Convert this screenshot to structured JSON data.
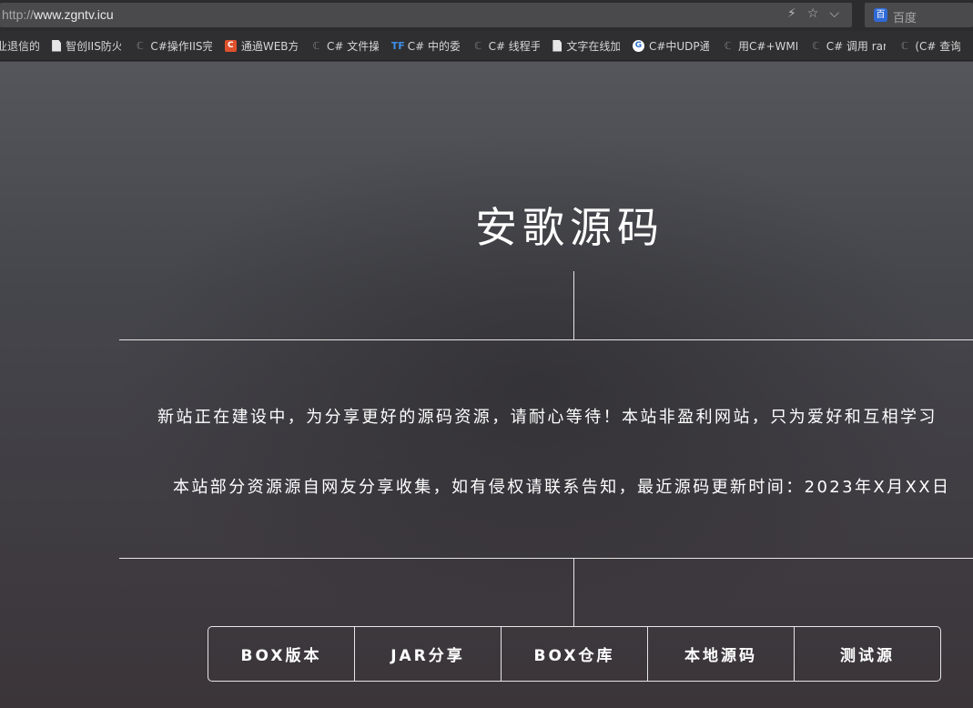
{
  "browser": {
    "url_protocol": "http://",
    "url_host": "www.zgntv.icu",
    "url_icons": [
      "lightning-icon",
      "star-icon",
      "chevron-down-icon"
    ],
    "search_logo": "百",
    "search_placeholder": "百度"
  },
  "bookmarks": [
    {
      "icon": "none",
      "label": "业退信的"
    },
    {
      "icon": "doc",
      "label": "智创IIS防火"
    },
    {
      "icon": "csdn",
      "label": "C#操作IIS完"
    },
    {
      "icon": "c",
      "label": "通過WEB方"
    },
    {
      "icon": "csdn",
      "label": "C# 文件操"
    },
    {
      "icon": "tf",
      "label": "C# 中的委"
    },
    {
      "icon": "csdn",
      "label": "C# 线程手"
    },
    {
      "icon": "doc",
      "label": "文字在线加"
    },
    {
      "icon": "g",
      "label": "C#中UDP通"
    },
    {
      "icon": "csdn",
      "label": "用C#+WMI"
    },
    {
      "icon": "csdn",
      "label": "C# 调用 rar"
    },
    {
      "icon": "csdn",
      "label": "(C# 查询"
    }
  ],
  "page": {
    "title": "安歌源码",
    "notice_1": "新站正在建设中，为分享更好的源码资源，请耐心等待！本站非盈利网站，只为爱好和互相学习",
    "notice_2": "本站部分资源源自网友分享收集，如有侵权请联系告知，最近源码更新时间：2023年X月XX日",
    "nav": [
      {
        "label": "BOX版本"
      },
      {
        "label": "JAR分享"
      },
      {
        "label": "BOX仓库"
      },
      {
        "label": "本地源码"
      },
      {
        "label": "测试源"
      }
    ]
  },
  "colors": {
    "text": "#ffffff",
    "line": "#e6e6e6",
    "chrome_bg": "#2c2c2e"
  }
}
